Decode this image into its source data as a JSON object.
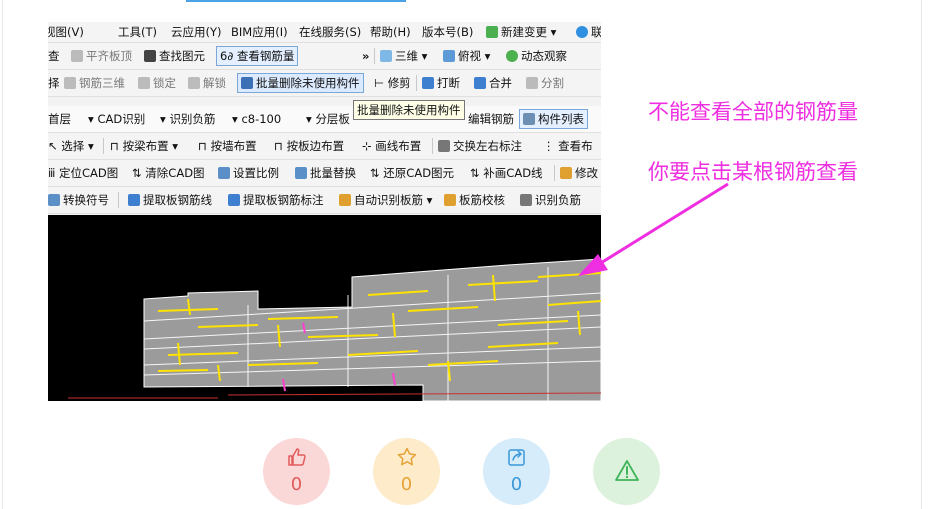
{
  "toolbar": {
    "menu_items": [
      "视图(V)",
      "工具(T)",
      "云应用(Y)",
      "BIM应用(I)",
      "在线服务(S)",
      "帮助(H)",
      "版本号(B)",
      "新建变更",
      "联"
    ],
    "row1": [
      "查",
      "平齐板顶",
      "查找图元",
      "查看钢筋量",
      "三维",
      "俯视",
      "动态观察"
    ],
    "row2": [
      "择",
      "钢筋三维",
      "锁定",
      "解锁",
      "批量删除未使用构件",
      "修剪",
      "打断",
      "合并",
      "分割"
    ],
    "row3": [
      "首层",
      "CAD识别",
      "识别负筋",
      "c8-100",
      "分层板",
      "编辑钢筋",
      "构件列表"
    ],
    "row4": [
      "选择",
      "按梁布置",
      "按墙布置",
      "按板边布置",
      "画线布置",
      "交换左右标注",
      "查看布"
    ],
    "row5": [
      "定位CAD图",
      "清除CAD图",
      "设置比例",
      "批量替换",
      "还原CAD图元",
      "补画CAD线",
      "修改"
    ],
    "row6": [
      "转换符号",
      "提取板钢筋线",
      "提取板钢筋标注",
      "自动识别板筋",
      "板筋校核",
      "识别负筋"
    ]
  },
  "tooltip": "批量删除未使用构件",
  "annotations": {
    "line1": "不能查看全部的钢筋量",
    "line2": "你要点击某根钢筋查看",
    "color": "#ee2ee0"
  },
  "actions": [
    {
      "name": "like",
      "icon": "thumb-up-icon",
      "count": "0",
      "bg": "#fbd8d8",
      "fg": "#e25b5b"
    },
    {
      "name": "favorite",
      "icon": "star-icon",
      "count": "0",
      "bg": "#fdebc9",
      "fg": "#e6a238"
    },
    {
      "name": "share",
      "icon": "share-icon",
      "count": "0",
      "bg": "#d6ecfa",
      "fg": "#3c98d8"
    },
    {
      "name": "report",
      "icon": "warning-icon",
      "count": "",
      "bg": "#dcf2dc",
      "fg": "#3fb45a"
    }
  ]
}
